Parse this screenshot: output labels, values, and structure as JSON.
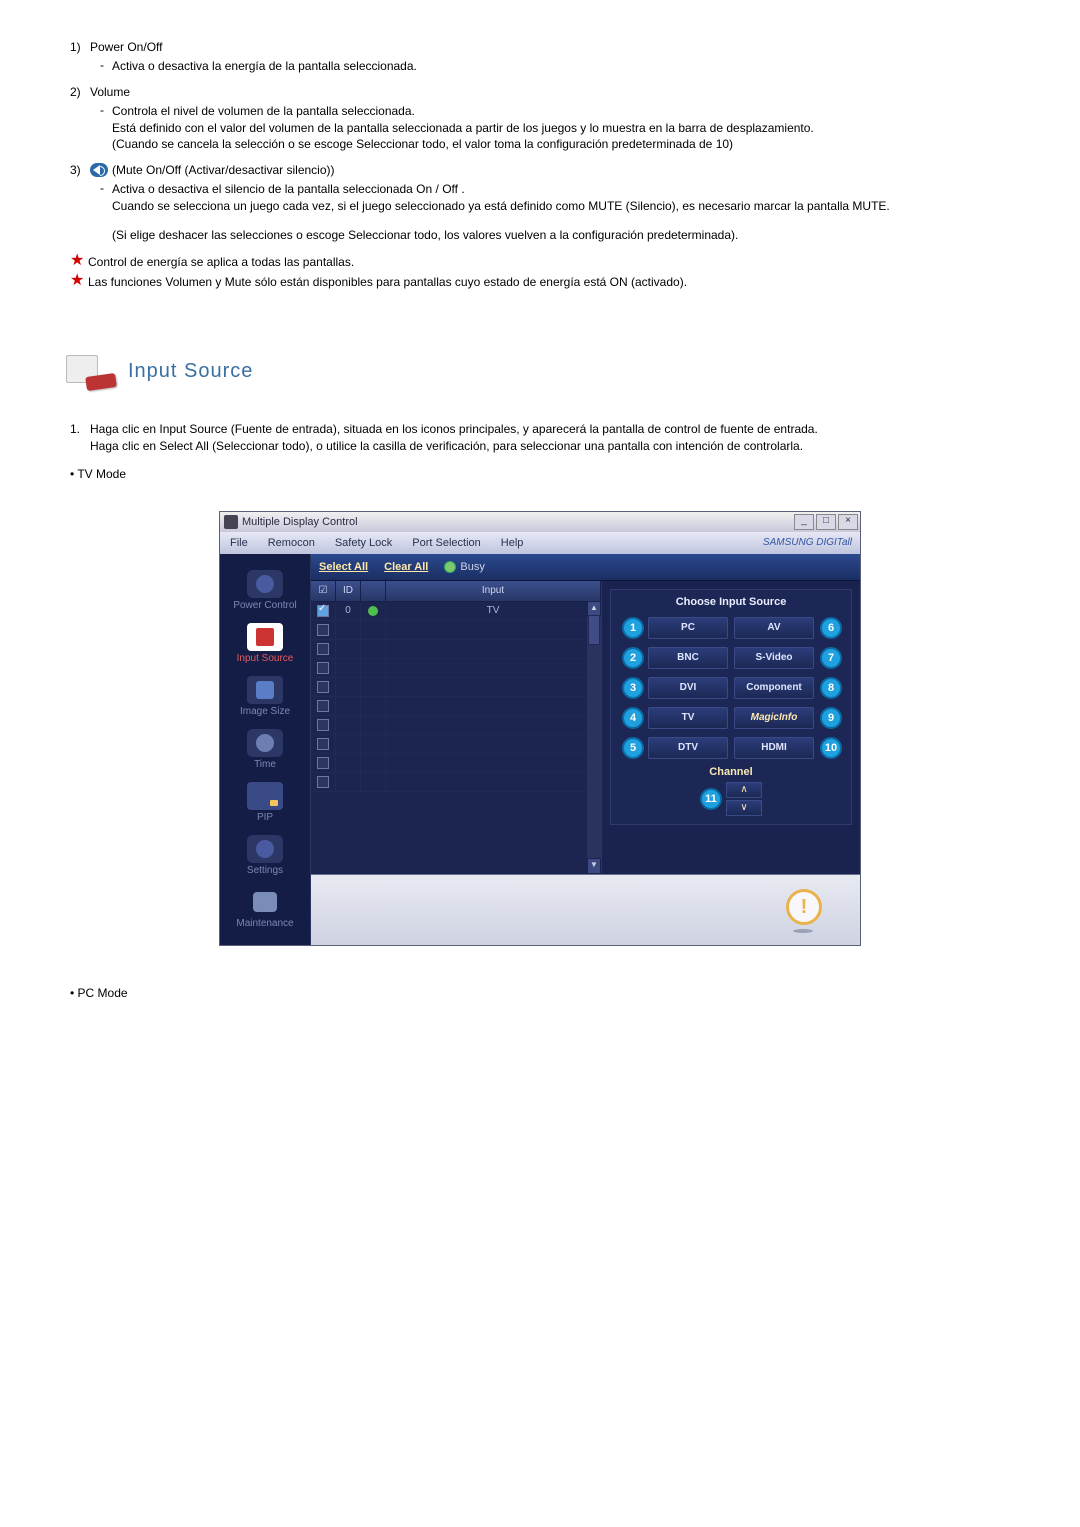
{
  "list": {
    "item1": {
      "num": "1)",
      "title": "Power On/Off",
      "dash": "-",
      "desc": "Activa o desactiva la energía de la pantalla seleccionada."
    },
    "item2": {
      "num": "2)",
      "title": "Volume",
      "dash": "-",
      "d1": "Controla el nivel de volumen de la pantalla seleccionada.",
      "d2": "Está definido con el valor del volumen de la pantalla seleccionada a partir de los juegos y lo muestra en la barra de desplazamiento.",
      "d3": "(Cuando se cancela la selección o se escoge Seleccionar todo, el valor toma la configuración predeterminada de 10)"
    },
    "item3": {
      "num": "3)",
      "title": "(Mute On/Off (Activar/desactivar silencio))",
      "dash": "-",
      "d1": "Activa o desactiva el silencio de la pantalla seleccionada On / Off .",
      "d2": "Cuando se selecciona un juego cada vez, si el juego seleccionado ya está definido como MUTE (Silencio), es necesario marcar la pantalla MUTE.",
      "d3": "(Si elige deshacer las selecciones o escoge Seleccionar todo, los valores vuelven a la configuración predeterminada)."
    }
  },
  "notes": {
    "n1": "Control de energía se aplica a todas las pantallas.",
    "n2": "Las funciones Volumen y Mute sólo están disponibles para pantallas cuyo estado de energía está ON (activado)."
  },
  "section": {
    "title": "Input Source"
  },
  "intro": {
    "num": "1.",
    "p1": "Haga clic en Input Source (Fuente de entrada), situada en los iconos principales, y aparecerá la pantalla de control de fuente de entrada.",
    "p2": "Haga clic en Select All (Seleccionar todo), o utilice la casilla de verificación, para seleccionar una pantalla con intención de controlarla."
  },
  "bullets": {
    "tv": "• TV Mode",
    "pc": "• PC Mode"
  },
  "app": {
    "title": "Multiple Display Control",
    "menus": {
      "file": "File",
      "remocon": "Remocon",
      "safety": "Safety Lock",
      "port": "Port Selection",
      "help": "Help"
    },
    "brand": "SAMSUNG DIGITall",
    "sidebar": {
      "power": "Power Control",
      "input": "Input Source",
      "image": "Image Size",
      "time": "Time",
      "pip": "PIP",
      "settings": "Settings",
      "maint": "Maintenance"
    },
    "mainbar": {
      "select_all": "Select All",
      "clear_all": "Clear All",
      "busy": "Busy"
    },
    "table": {
      "headers": {
        "chk": "☑",
        "id": "ID",
        "status": "",
        "input": "Input"
      },
      "rows": [
        {
          "checked": true,
          "id": "0",
          "status": true,
          "input": "TV"
        },
        {
          "checked": false,
          "id": "",
          "status": false,
          "input": ""
        },
        {
          "checked": false,
          "id": "",
          "status": false,
          "input": ""
        },
        {
          "checked": false,
          "id": "",
          "status": false,
          "input": ""
        },
        {
          "checked": false,
          "id": "",
          "status": false,
          "input": ""
        },
        {
          "checked": false,
          "id": "",
          "status": false,
          "input": ""
        },
        {
          "checked": false,
          "id": "",
          "status": false,
          "input": ""
        },
        {
          "checked": false,
          "id": "",
          "status": false,
          "input": ""
        },
        {
          "checked": false,
          "id": "",
          "status": false,
          "input": ""
        },
        {
          "checked": false,
          "id": "",
          "status": false,
          "input": ""
        }
      ]
    },
    "chooser": {
      "title": "Choose Input Source",
      "left": [
        {
          "n": "1",
          "l": "PC"
        },
        {
          "n": "2",
          "l": "BNC"
        },
        {
          "n": "3",
          "l": "DVI"
        },
        {
          "n": "4",
          "l": "TV"
        },
        {
          "n": "5",
          "l": "DTV"
        }
      ],
      "right": [
        {
          "n": "6",
          "l": "AV"
        },
        {
          "n": "7",
          "l": "S-Video"
        },
        {
          "n": "8",
          "l": "Component"
        },
        {
          "n": "9",
          "l": "MagicInfo"
        },
        {
          "n": "10",
          "l": "HDMI"
        }
      ],
      "channel_label": "Channel",
      "channel_callout": "11"
    }
  }
}
